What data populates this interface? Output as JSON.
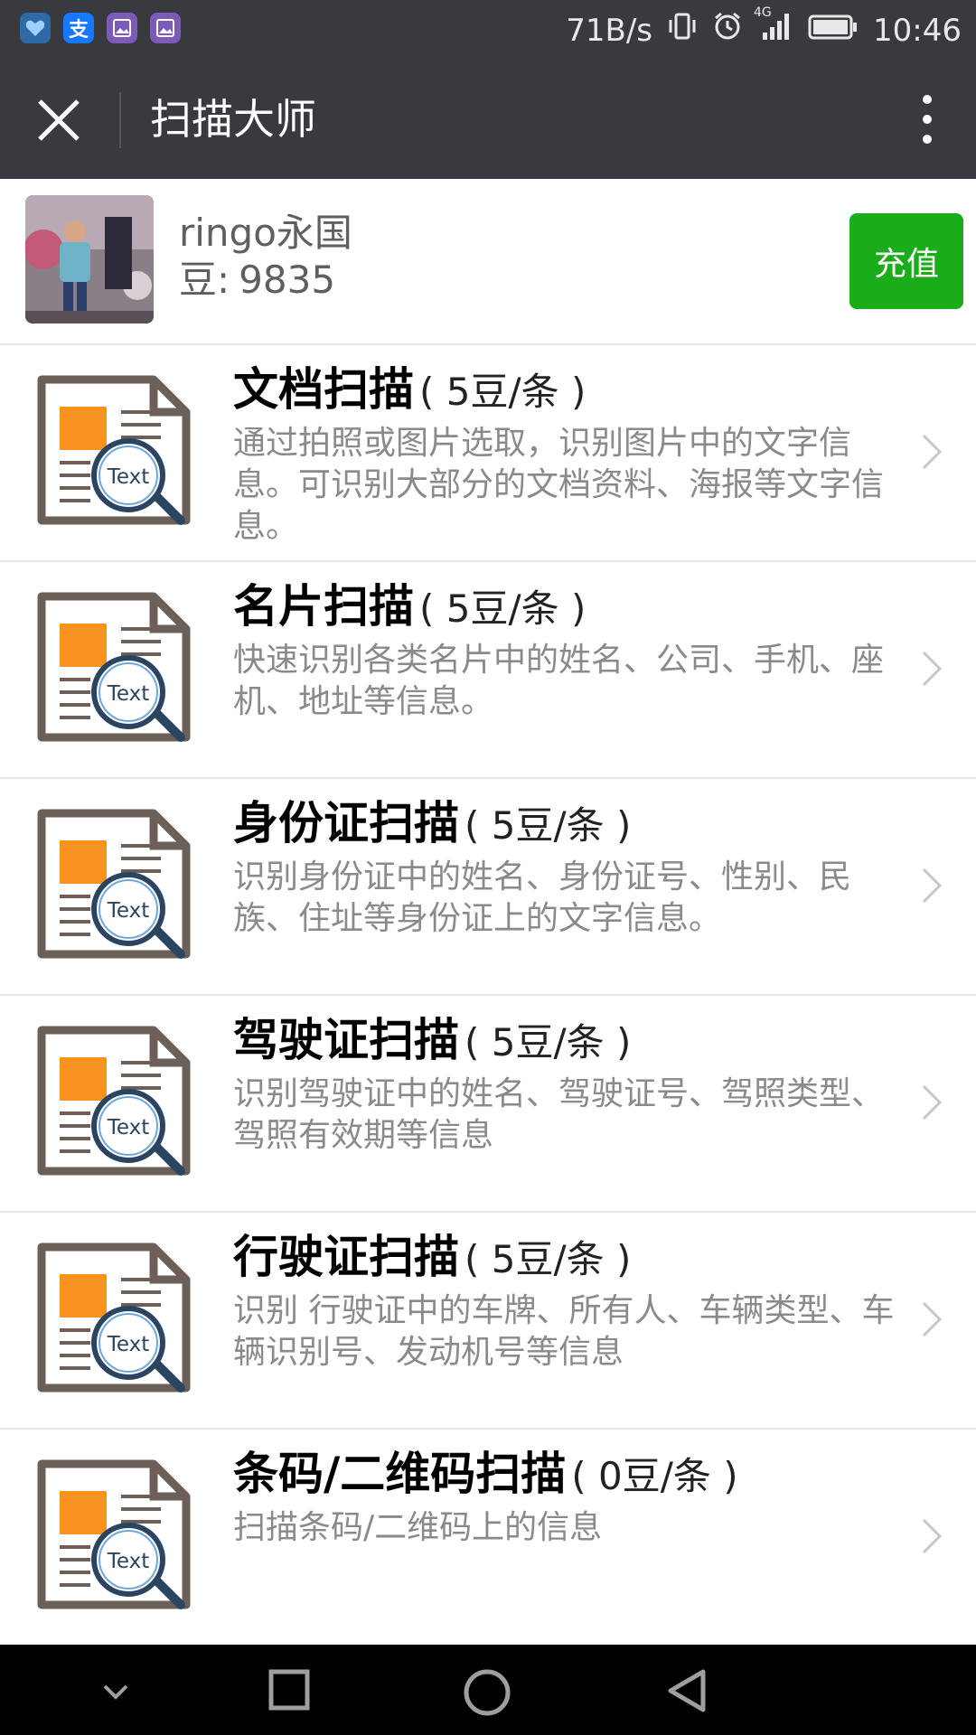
{
  "status_bar": {
    "net_speed": "71B/s",
    "network": "4G",
    "time": "10:46"
  },
  "nav": {
    "title": "扫描大师"
  },
  "profile": {
    "username": "ringo永国",
    "beans_label": "豆:",
    "beans_value": "9835",
    "recharge_label": "充值"
  },
  "items": [
    {
      "title": "文档扫描",
      "price": "( 5豆/条 )",
      "desc": "通过拍照或图片选取，识别图片中的文字信息。可识别大部分的文档资料、海报等文字信息。"
    },
    {
      "title": "名片扫描",
      "price": "( 5豆/条 )",
      "desc": "快速识别各类名片中的姓名、公司、手机、座机、地址等信息。"
    },
    {
      "title": "身份证扫描",
      "price": "( 5豆/条 )",
      "desc": "识别身份证中的姓名、身份证号、性别、民族、住址等身份证上的文字信息。"
    },
    {
      "title": "驾驶证扫描",
      "price": "( 5豆/条 )",
      "desc": "识别驾驶证中的姓名、驾驶证号、驾照类型、驾照有效期等信息"
    },
    {
      "title": "行驶证扫描",
      "price": "( 5豆/条 )",
      "desc": "识别 行驶证中的车牌、所有人、车辆类型、车辆识别号、发动机号等信息"
    },
    {
      "title": "条码/二维码扫描",
      "price": "( 0豆/条 )",
      "desc": "扫描条码/二维码上的信息"
    }
  ],
  "icon_text": "Text",
  "colors": {
    "header_bg": "#393a3f",
    "accent_green": "#1aad19",
    "icon_orange": "#f7931e"
  }
}
